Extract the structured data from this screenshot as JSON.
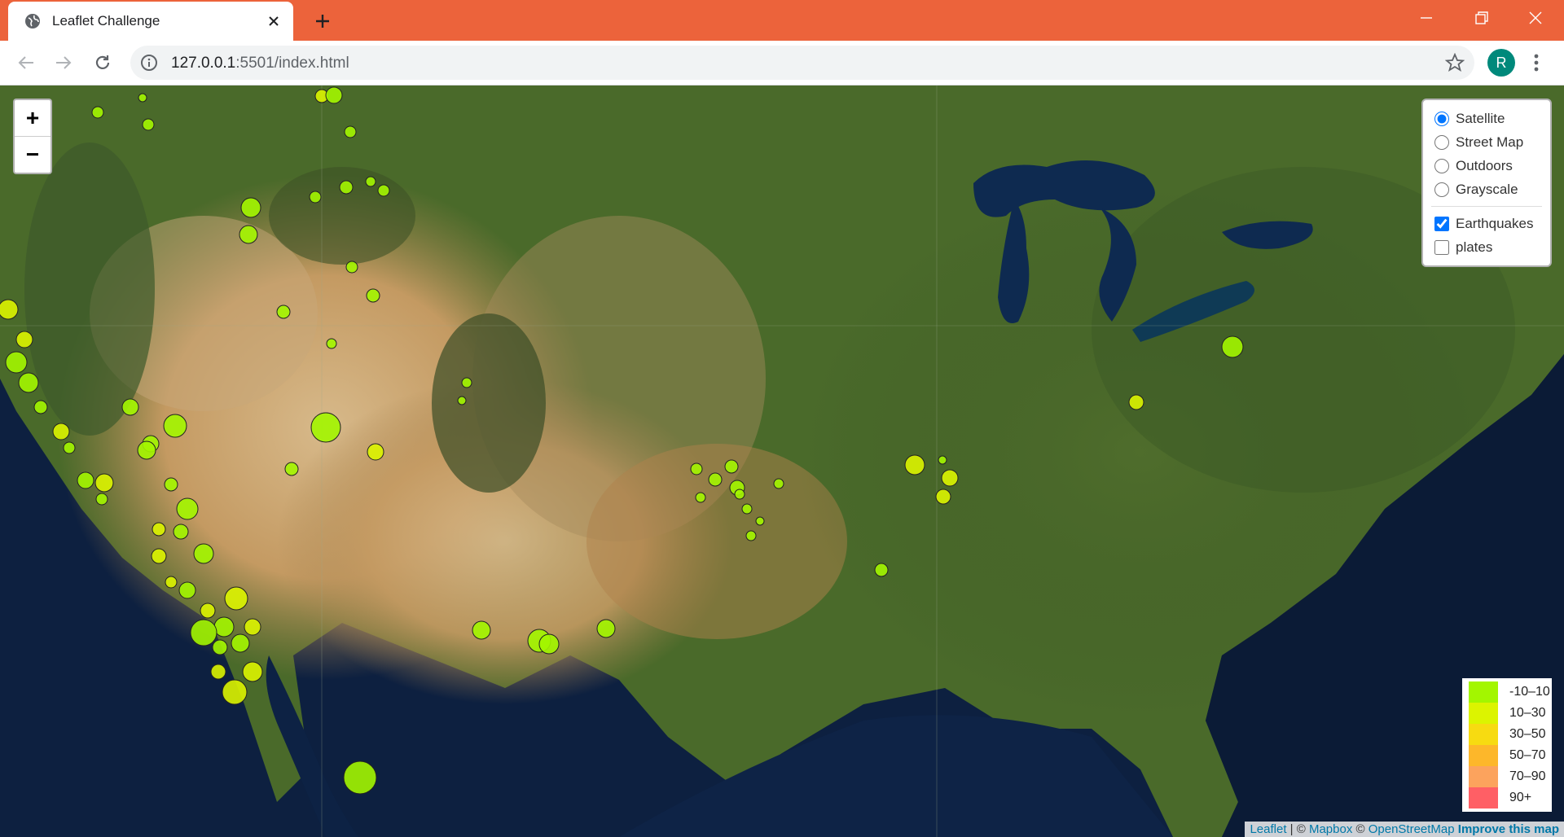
{
  "tab": {
    "title": "Leaflet Challenge"
  },
  "address": {
    "host": "127.0.0.1",
    "rest": ":5501/index.html"
  },
  "profile": {
    "initial": "R"
  },
  "map": {
    "zoom_in": "+",
    "zoom_out": "−",
    "base_layers": [
      {
        "label": "Satellite",
        "selected": true
      },
      {
        "label": "Street Map",
        "selected": false
      },
      {
        "label": "Outdoors",
        "selected": false
      },
      {
        "label": "Grayscale",
        "selected": false
      }
    ],
    "overlays": [
      {
        "label": "Earthquakes",
        "checked": true
      },
      {
        "label": "plates",
        "checked": false
      }
    ],
    "legend": [
      {
        "label": "-10–10",
        "color": "#a3f600"
      },
      {
        "label": "10–30",
        "color": "#dcf400"
      },
      {
        "label": "30–50",
        "color": "#f7db11"
      },
      {
        "label": "50–70",
        "color": "#fdb72a"
      },
      {
        "label": "70–90",
        "color": "#fca35d"
      },
      {
        "label": "90+",
        "color": "#ff5f65"
      }
    ],
    "attribution": {
      "leaflet": "Leaflet",
      "sep1": " | © ",
      "mapbox": "Mapbox",
      "sep2": " © ",
      "osm": "OpenStreetMap",
      "improve": "Improve this map"
    }
  },
  "colors": {
    "tab_strip": "#ec633b",
    "avatar": "#00897b"
  }
}
